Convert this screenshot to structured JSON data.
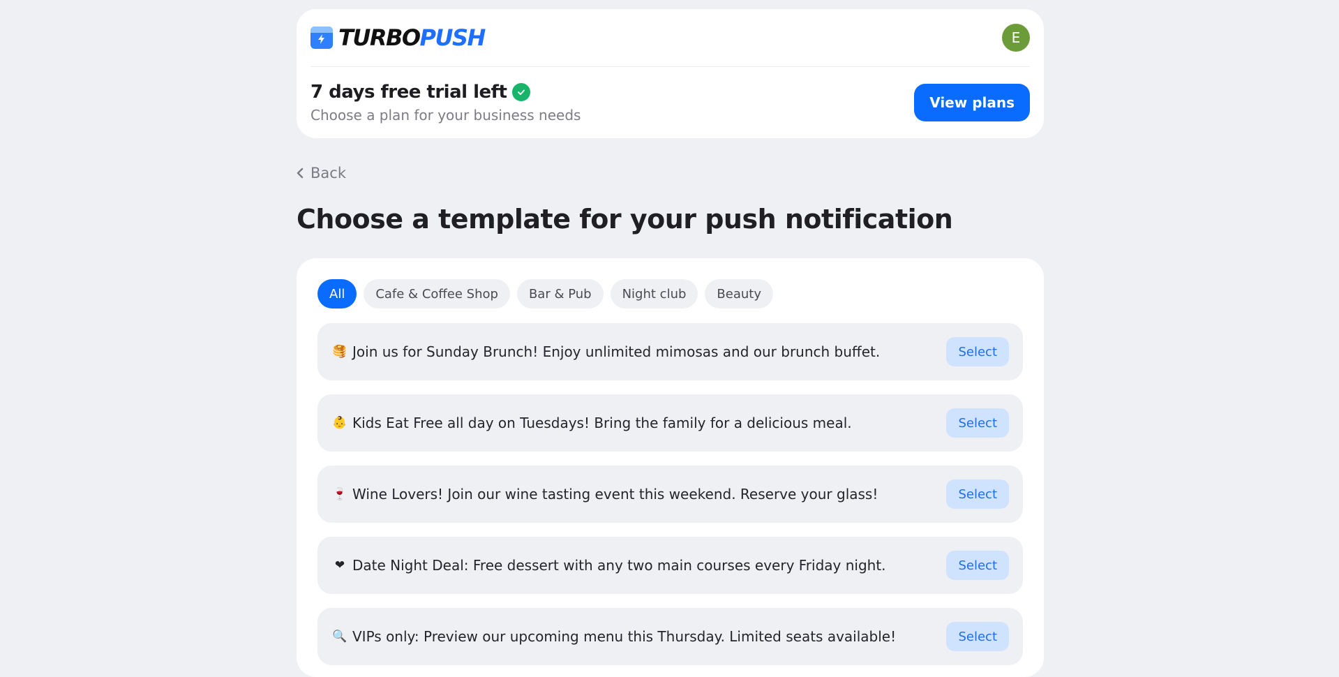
{
  "brand": {
    "name_part1": "TURBO",
    "name_part2": "PUSH",
    "colors": {
      "primary": "#0a6cff",
      "dark": "#111111"
    }
  },
  "user": {
    "avatar_letter": "E",
    "avatar_color": "#6c9b3a"
  },
  "trial": {
    "title": "7 days free trial left",
    "subtitle": "Choose a plan for your business needs",
    "cta_label": "View plans"
  },
  "nav": {
    "back_label": "Back"
  },
  "page": {
    "title": "Choose a template for your push notification"
  },
  "filters": {
    "chips": [
      {
        "label": "All",
        "active": true
      },
      {
        "label": "Cafe & Coffee Shop",
        "active": false
      },
      {
        "label": "Bar & Pub",
        "active": false
      },
      {
        "label": "Night club",
        "active": false
      },
      {
        "label": "Beauty",
        "active": false
      }
    ]
  },
  "templates": {
    "select_label": "Select",
    "items": [
      {
        "icon": "pancakes-icon",
        "emoji": "🥞",
        "text": "Join us for Sunday Brunch! Enjoy unlimited mimosas and our brunch buffet."
      },
      {
        "icon": "baby-icon",
        "emoji": "👶",
        "text": "Kids Eat Free all day on Tuesdays! Bring the family for a delicious meal."
      },
      {
        "icon": "wine-glass-icon",
        "emoji": "🍷",
        "text": "Wine Lovers! Join our wine tasting event this weekend. Reserve your glass!"
      },
      {
        "icon": "heart-icon",
        "emoji": "❤",
        "text": "Date Night Deal: Free dessert with any two main courses every Friday night."
      },
      {
        "icon": "magnifier-icon",
        "emoji": "🔍",
        "text": "VIPs only: Preview our upcoming menu this Thursday. Limited seats available!"
      }
    ]
  }
}
